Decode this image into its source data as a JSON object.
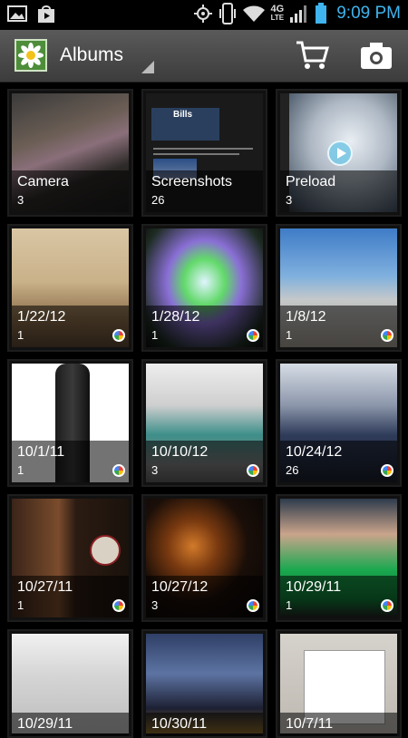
{
  "status_bar": {
    "time": "9:09 PM",
    "network": "4G",
    "network_sub": "LTE",
    "icons": [
      "image-notification-icon",
      "play-store-icon",
      "gps-icon",
      "vibrate-icon",
      "wifi-icon",
      "signal-icon",
      "battery-icon"
    ]
  },
  "action_bar": {
    "title": "Albums",
    "icons": [
      "albums-app-icon",
      "cart-icon",
      "camera-icon"
    ]
  },
  "albums": [
    {
      "name": "Camera",
      "count": "3"
    },
    {
      "name": "Screenshots",
      "count": "26"
    },
    {
      "name": "Preload",
      "count": "3"
    },
    {
      "name": "1/22/12",
      "count": "1"
    },
    {
      "name": "1/28/12",
      "count": "1"
    },
    {
      "name": "1/8/12",
      "count": "1"
    },
    {
      "name": "10/1/11",
      "count": "1"
    },
    {
      "name": "10/10/12",
      "count": "3"
    },
    {
      "name": "10/24/12",
      "count": "26"
    },
    {
      "name": "10/27/11",
      "count": "1"
    },
    {
      "name": "10/27/12",
      "count": "3"
    },
    {
      "name": "10/29/11",
      "count": "1"
    },
    {
      "name": "10/29/11",
      "count": ""
    },
    {
      "name": "10/30/11",
      "count": ""
    },
    {
      "name": "10/7/11",
      "count": ""
    }
  ],
  "screenshot_thumb": {
    "label": "Bills"
  },
  "colors": {
    "status_time": "#3fb4ee",
    "battery": "#3fb4ee",
    "action_bar": "#4a4a4a"
  }
}
